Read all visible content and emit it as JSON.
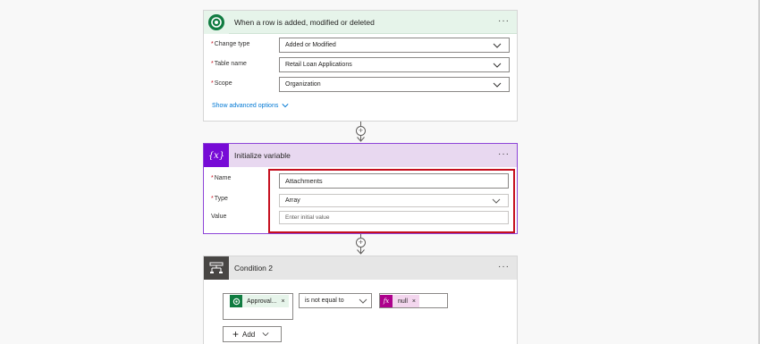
{
  "trigger": {
    "title": "When a row is added, modified or deleted",
    "fields": [
      {
        "label": "Change type",
        "required": true,
        "value": "Added or Modified"
      },
      {
        "label": "Table name",
        "required": true,
        "value": "Retail Loan Applications"
      },
      {
        "label": "Scope",
        "required": true,
        "value": "Organization"
      }
    ],
    "show_advanced": "Show advanced options",
    "color": "#e6f4ea",
    "icon_color": "#107c41"
  },
  "init_var": {
    "title": "Initialize variable",
    "icon_text": "{x}",
    "name_label": "Name",
    "name_value": "Attachments",
    "type_label": "Type",
    "type_value": "Array",
    "value_label": "Value",
    "value_placeholder": "Enter initial value",
    "color": "#e8d8f0",
    "icon_color": "#770bd6"
  },
  "condition": {
    "title": "Condition 2",
    "left_token": "Approval...",
    "operator": "is not equal to",
    "right_token": "null",
    "right_token_icon": "fx",
    "add_label": "Add",
    "color": "#e6e6e6",
    "icon_color": "#484644"
  },
  "more_label": "···",
  "plus_label": "+",
  "remove_label": "×"
}
